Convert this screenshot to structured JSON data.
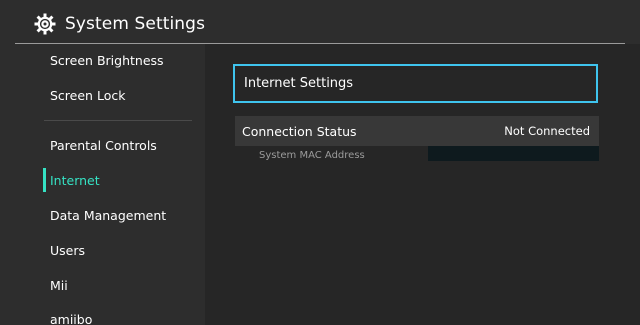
{
  "header": {
    "title": "System Settings",
    "icon": "gear-icon"
  },
  "sidebar": {
    "items": [
      {
        "label": "Screen Brightness"
      },
      {
        "label": "Screen Lock"
      },
      {
        "label": "Parental Controls"
      },
      {
        "label": "Internet",
        "active": true
      },
      {
        "label": "Data Management"
      },
      {
        "label": "Users"
      },
      {
        "label": "Mii"
      },
      {
        "label": "amiibo"
      }
    ]
  },
  "main": {
    "internet_settings_label": "Internet Settings",
    "connection_status": {
      "label": "Connection Status",
      "value": "Not Connected"
    },
    "mac_address": {
      "label": "System MAC Address",
      "value": ""
    }
  },
  "colors": {
    "accent_active": "#35e2c4",
    "focus_border": "#3fc4ee",
    "background": "#2d2d2d"
  }
}
